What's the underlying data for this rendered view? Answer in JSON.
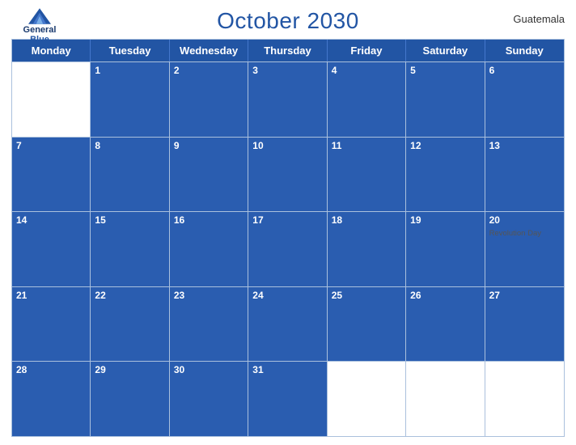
{
  "header": {
    "title": "October 2030",
    "country": "Guatemala",
    "logo": {
      "line1": "General",
      "line2": "Blue"
    }
  },
  "dayHeaders": [
    "Monday",
    "Tuesday",
    "Wednesday",
    "Thursday",
    "Friday",
    "Saturday",
    "Sunday"
  ],
  "weeks": [
    [
      {
        "number": "",
        "holiday": "",
        "isHeader": true,
        "isEmpty": true
      },
      {
        "number": "1",
        "holiday": "",
        "isHeader": true
      },
      {
        "number": "2",
        "holiday": "",
        "isHeader": true
      },
      {
        "number": "3",
        "holiday": "",
        "isHeader": true
      },
      {
        "number": "4",
        "holiday": "",
        "isHeader": true
      },
      {
        "number": "5",
        "holiday": "",
        "isHeader": true
      },
      {
        "number": "6",
        "holiday": "",
        "isHeader": true
      }
    ],
    [
      {
        "number": "7",
        "holiday": "",
        "isHeader": true
      },
      {
        "number": "8",
        "holiday": "",
        "isHeader": true
      },
      {
        "number": "9",
        "holiday": "",
        "isHeader": true
      },
      {
        "number": "10",
        "holiday": "",
        "isHeader": true
      },
      {
        "number": "11",
        "holiday": "",
        "isHeader": true
      },
      {
        "number": "12",
        "holiday": "",
        "isHeader": true
      },
      {
        "number": "13",
        "holiday": "",
        "isHeader": true
      }
    ],
    [
      {
        "number": "14",
        "holiday": "",
        "isHeader": true
      },
      {
        "number": "15",
        "holiday": "",
        "isHeader": true
      },
      {
        "number": "16",
        "holiday": "",
        "isHeader": true
      },
      {
        "number": "17",
        "holiday": "",
        "isHeader": true
      },
      {
        "number": "18",
        "holiday": "",
        "isHeader": true
      },
      {
        "number": "19",
        "holiday": "",
        "isHeader": true
      },
      {
        "number": "20",
        "holiday": "Revolution Day",
        "isHeader": true
      }
    ],
    [
      {
        "number": "21",
        "holiday": "",
        "isHeader": true
      },
      {
        "number": "22",
        "holiday": "",
        "isHeader": true
      },
      {
        "number": "23",
        "holiday": "",
        "isHeader": true
      },
      {
        "number": "24",
        "holiday": "",
        "isHeader": true
      },
      {
        "number": "25",
        "holiday": "",
        "isHeader": true
      },
      {
        "number": "26",
        "holiday": "",
        "isHeader": true
      },
      {
        "number": "27",
        "holiday": "",
        "isHeader": true
      }
    ],
    [
      {
        "number": "28",
        "holiday": "",
        "isHeader": true
      },
      {
        "number": "29",
        "holiday": "",
        "isHeader": true
      },
      {
        "number": "30",
        "holiday": "",
        "isHeader": true
      },
      {
        "number": "31",
        "holiday": "",
        "isHeader": true
      },
      {
        "number": "",
        "holiday": "",
        "isHeader": false,
        "isEmpty": true
      },
      {
        "number": "",
        "holiday": "",
        "isHeader": false,
        "isEmpty": true
      },
      {
        "number": "",
        "holiday": "",
        "isHeader": false,
        "isEmpty": true
      }
    ]
  ]
}
